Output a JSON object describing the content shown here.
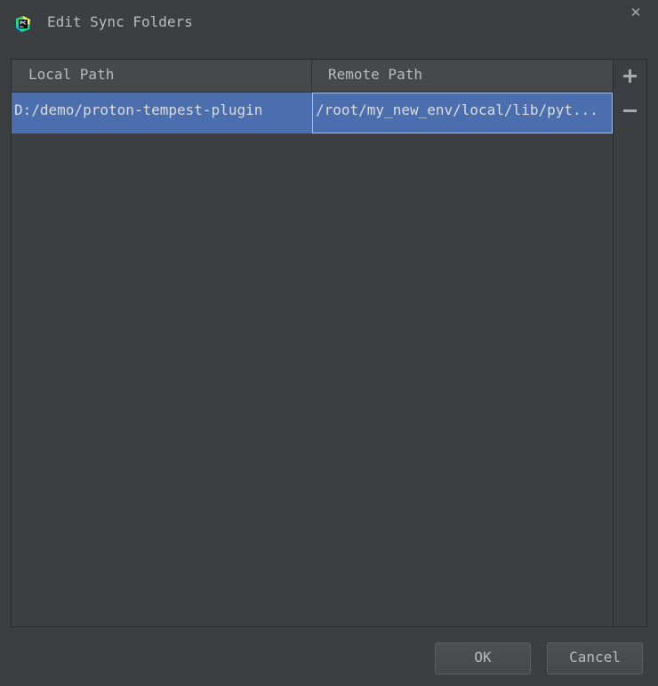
{
  "window": {
    "title": "Edit Sync Folders",
    "app_icon": "pycharm-icon",
    "close_label": "✕"
  },
  "table": {
    "columns": [
      "Local Path",
      "Remote Path"
    ],
    "rows": [
      {
        "local_path": "D:/demo/proton-tempest-plugin",
        "remote_path": "/root/my_new_env/local/lib/pyt..."
      }
    ],
    "selection_color": "#4b6eaf"
  },
  "toolbar": {
    "add_icon": "plus-icon",
    "remove_icon": "minus-icon"
  },
  "footer": {
    "ok_label": "OK",
    "cancel_label": "Cancel"
  },
  "colors": {
    "background": "#3c3f41",
    "header": "#45494a",
    "text": "#bbbbbb"
  }
}
